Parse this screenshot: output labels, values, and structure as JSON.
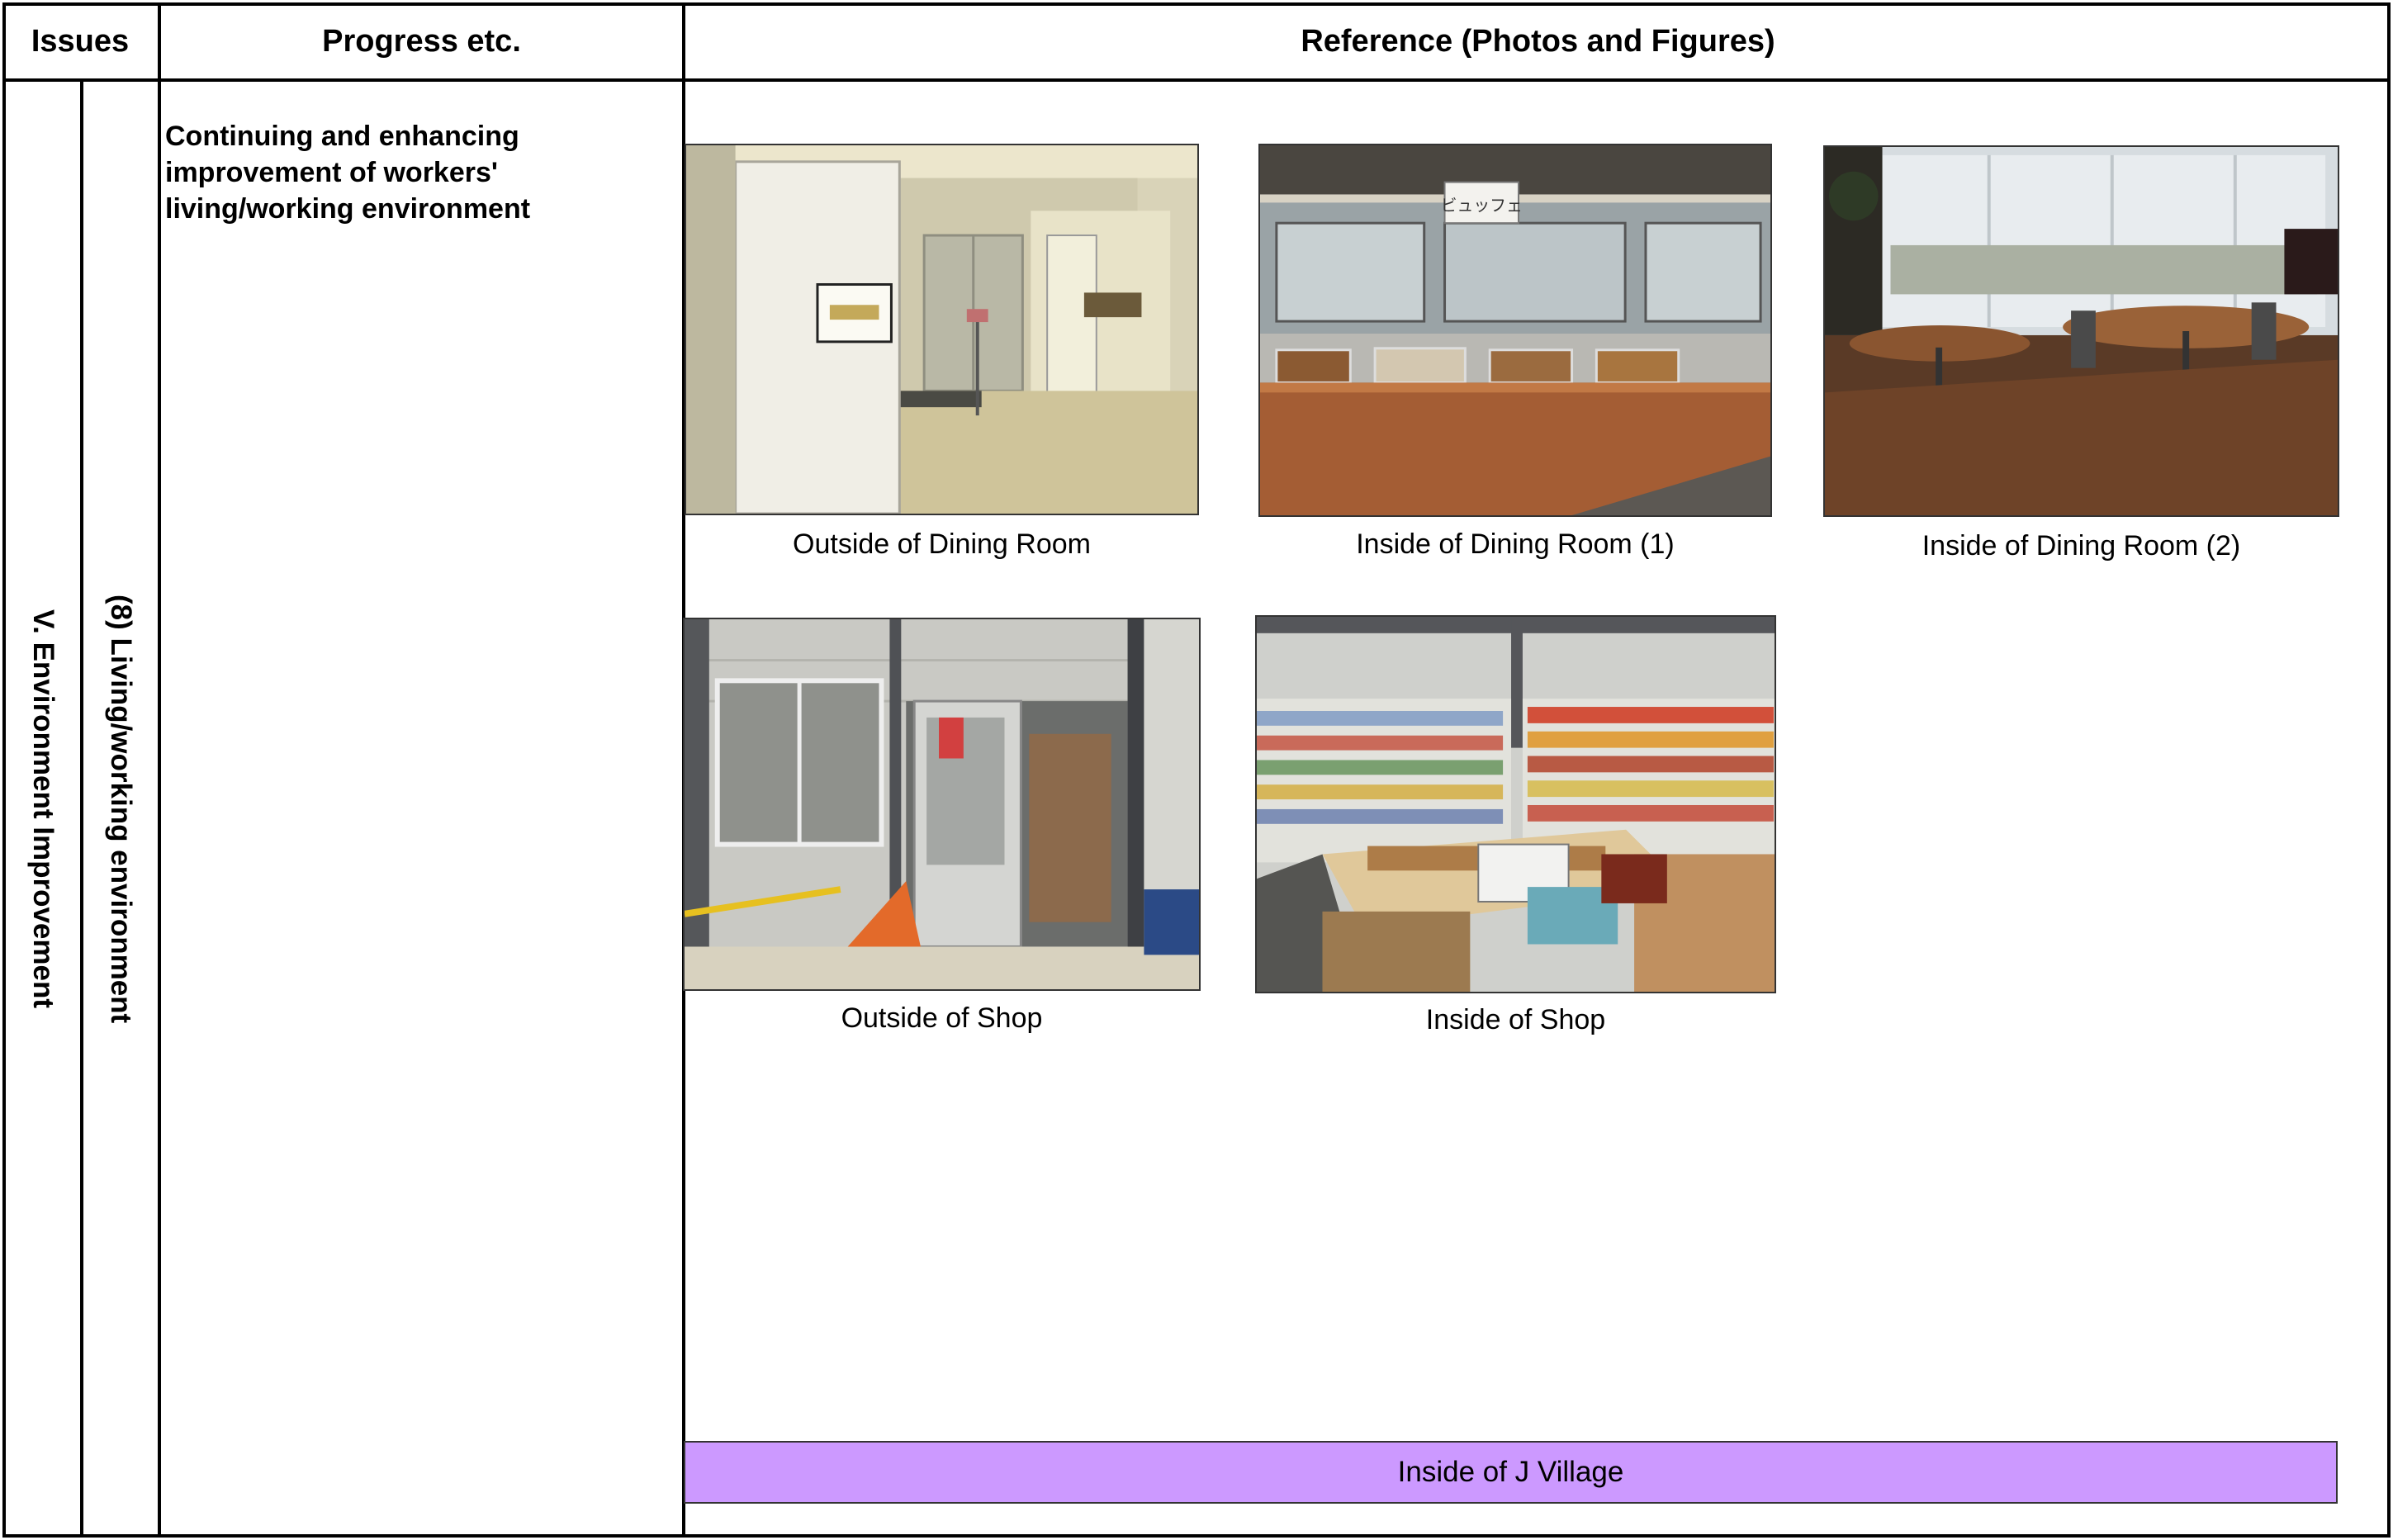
{
  "header": {
    "issues": "Issues",
    "progress": "Progress etc.",
    "reference": "Reference (Photos and Figures)"
  },
  "issue": {
    "category": "V. Environment Improvement",
    "subcategory": "(8) Living/working environment"
  },
  "progress_text": "Continuing and enhancing improvement of workers' living/working environment",
  "photos": [
    {
      "caption": "Outside of Dining Room",
      "icon": "dining-room-entrance-photo"
    },
    {
      "caption": "Inside of Dining Room (1)",
      "icon": "buffet-counter-photo",
      "sign_text": "ビュッフェ"
    },
    {
      "caption": "Inside of Dining Room (2)",
      "icon": "dining-tables-photo"
    },
    {
      "caption": "Outside of Shop",
      "icon": "shop-entrance-photo"
    },
    {
      "caption": "Inside of Shop",
      "icon": "shop-shelves-photo"
    }
  ],
  "banner": {
    "label": "Inside of J Village",
    "color": "#cc99ff"
  }
}
